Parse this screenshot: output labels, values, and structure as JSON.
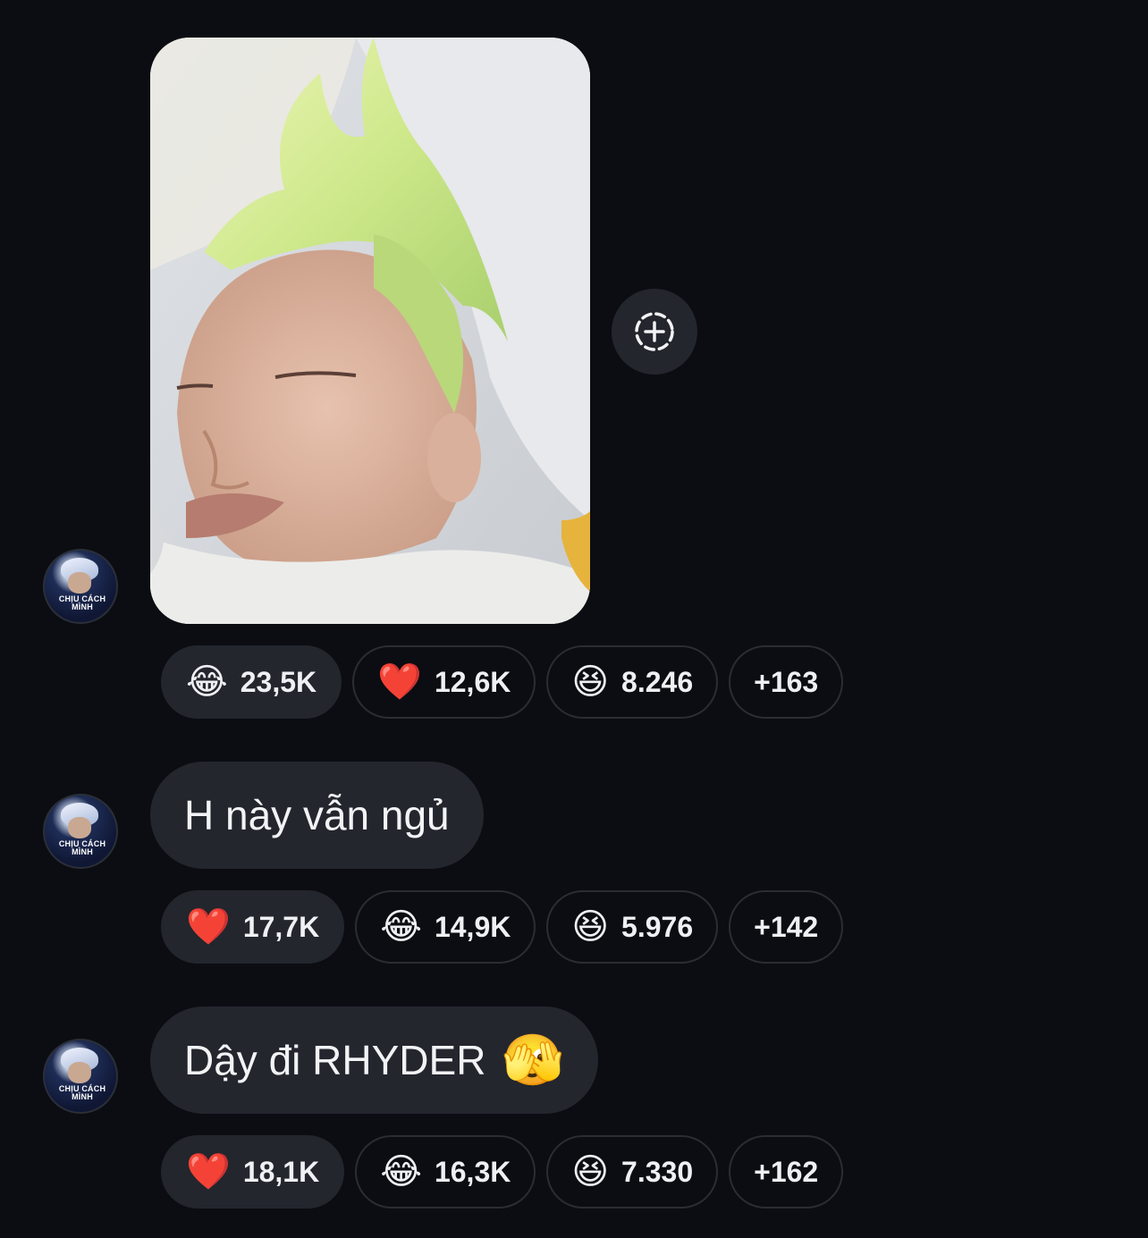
{
  "avatar": {
    "caption_line1": "CHỊU CÁCH",
    "caption_line2": "MÌNH"
  },
  "share_button": {
    "icon": "add-circle-dashed-icon"
  },
  "messages": [
    {
      "type": "image",
      "reactions": [
        {
          "emoji": "😂",
          "icon": "laughing-tears-icon",
          "count": "23,5K",
          "active": true
        },
        {
          "emoji": "❤️",
          "icon": "heart-icon",
          "count": "12,6K",
          "active": false
        },
        {
          "emoji": "😆",
          "icon": "grinning-squint-icon",
          "count": "8.246",
          "active": false
        },
        {
          "emoji": "",
          "icon": "",
          "count": "+163",
          "active": false
        }
      ]
    },
    {
      "type": "text",
      "text": "H này vẫn ngủ",
      "reactions": [
        {
          "emoji": "❤️",
          "icon": "heart-icon",
          "count": "17,7K",
          "active": true
        },
        {
          "emoji": "😂",
          "icon": "laughing-tears-icon",
          "count": "14,9K",
          "active": false
        },
        {
          "emoji": "😆",
          "icon": "grinning-squint-icon",
          "count": "5.976",
          "active": false
        },
        {
          "emoji": "",
          "icon": "",
          "count": "+142",
          "active": false
        }
      ]
    },
    {
      "type": "text",
      "text": "Dậy đi RHYDER",
      "trailing_emoji": "🫣",
      "reactions": [
        {
          "emoji": "❤️",
          "icon": "heart-icon",
          "count": "18,1K",
          "active": true
        },
        {
          "emoji": "😂",
          "icon": "laughing-tears-icon",
          "count": "16,3K",
          "active": false
        },
        {
          "emoji": "😆",
          "icon": "grinning-squint-icon",
          "count": "7.330",
          "active": false
        },
        {
          "emoji": "",
          "icon": "",
          "count": "+162",
          "active": false
        }
      ]
    }
  ],
  "colors": {
    "background": "#0b0d12",
    "bubble": "#23262d",
    "pill_border": "#2a2d34",
    "text": "#f1f3f5"
  }
}
